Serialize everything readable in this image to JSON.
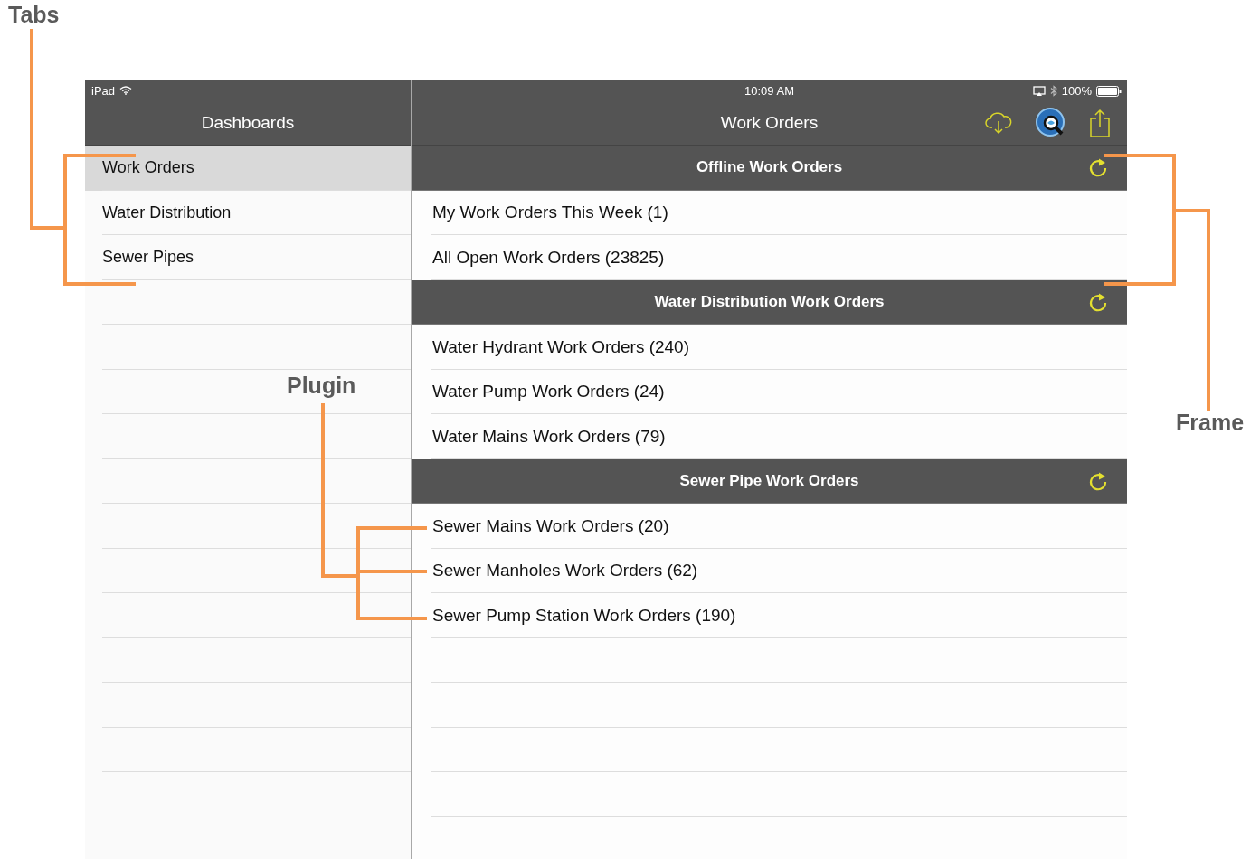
{
  "annotations": [
    {
      "kind": "tabs",
      "label": "Tabs"
    },
    {
      "kind": "plugin",
      "label": "Plugin"
    },
    {
      "kind": "frame",
      "label": "Frame"
    }
  ],
  "status_bar": {
    "device": "iPad",
    "time": "10:09 AM",
    "battery": "100%"
  },
  "sidebar": {
    "title": "Dashboards",
    "items": [
      {
        "label": "Work Orders",
        "selected": true
      },
      {
        "label": "Water Distribution",
        "selected": false
      },
      {
        "label": "Sewer Pipes",
        "selected": false
      }
    ]
  },
  "main": {
    "title": "Work Orders",
    "sections": [
      {
        "title": "Offline Work Orders",
        "items": [
          "My Work Orders This Week (1)",
          "All Open Work Orders (23825)"
        ]
      },
      {
        "title": "Water Distribution Work Orders",
        "items": [
          "Water Hydrant Work Orders (240)",
          "Water Pump Work Orders (24)",
          "Water Mains Work Orders (79)"
        ]
      },
      {
        "title": "Sewer Pipe Work Orders",
        "items": [
          "Sewer Mains Work Orders (20)",
          "Sewer Manholes Work Orders (62)",
          "Sewer Pump Station Work Orders (190)"
        ]
      }
    ]
  }
}
